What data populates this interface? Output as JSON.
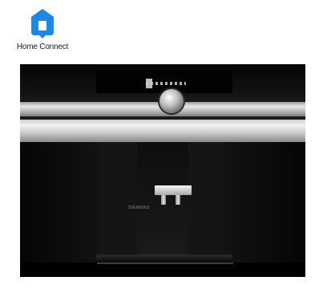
{
  "logo": {
    "text": "Home Connect",
    "icon": "home-connect-house-icon",
    "color": "#1e88e5"
  },
  "appliance": {
    "brand": "SIEMENS"
  }
}
